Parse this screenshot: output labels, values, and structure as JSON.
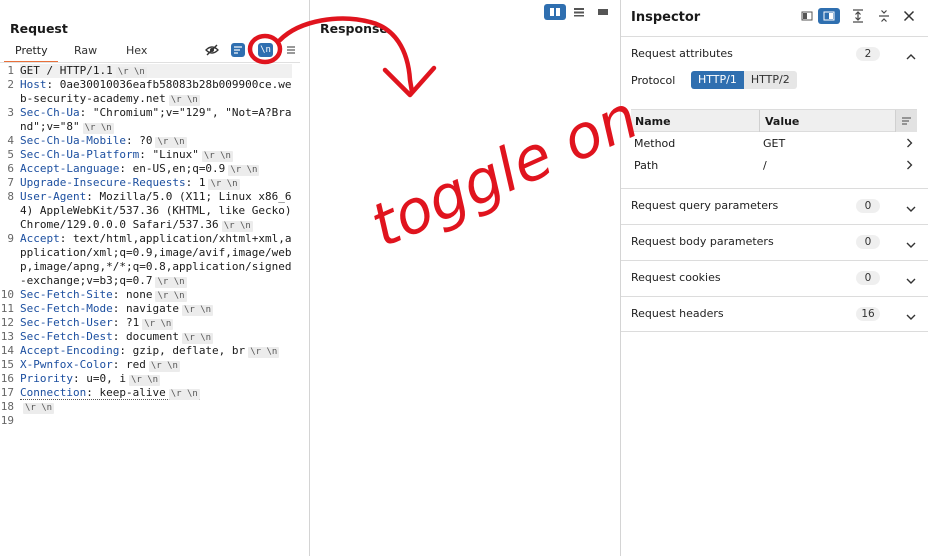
{
  "request": {
    "title": "Request",
    "tabs": [
      "Pretty",
      "Raw",
      "Hex"
    ],
    "newline_toggle": "\\n",
    "crlf": "\\r \\n",
    "lines": [
      {
        "num": "1",
        "key": "",
        "value": "GET / HTTP/1.1",
        "crlf": true
      },
      {
        "num": "2",
        "key": "Host",
        "value": "0ae30010036eafb58083b28b009900ce.web-security-academy.net",
        "crlf": true
      },
      {
        "num": "3",
        "key": "Sec-Ch-Ua",
        "value": "\"Chromium\";v=\"129\", \"Not=A?Brand\";v=\"8\"",
        "crlf": true
      },
      {
        "num": "4",
        "key": "Sec-Ch-Ua-Mobile",
        "value": "?0",
        "crlf": true
      },
      {
        "num": "5",
        "key": "Sec-Ch-Ua-Platform",
        "value": "\"Linux\"",
        "crlf": true
      },
      {
        "num": "6",
        "key": "Accept-Language",
        "value": "en-US,en;q=0.9",
        "crlf": true
      },
      {
        "num": "7",
        "key": "Upgrade-Insecure-Requests",
        "value": "1",
        "crlf": true
      },
      {
        "num": "8",
        "key": "User-Agent",
        "value": "Mozilla/5.0 (X11; Linux x86_64) AppleWebKit/537.36 (KHTML, like Gecko) Chrome/129.0.0.0 Safari/537.36",
        "crlf": true
      },
      {
        "num": "9",
        "key": "Accept",
        "value": "text/html,application/xhtml+xml,application/xml;q=0.9,image/avif,image/webp,image/apng,*/*;q=0.8,application/signed-exchange;v=b3;q=0.7",
        "crlf": true
      },
      {
        "num": "10",
        "key": "Sec-Fetch-Site",
        "value": "none",
        "crlf": true
      },
      {
        "num": "11",
        "key": "Sec-Fetch-Mode",
        "value": "navigate",
        "crlf": true
      },
      {
        "num": "12",
        "key": "Sec-Fetch-User",
        "value": "?1",
        "crlf": true
      },
      {
        "num": "13",
        "key": "Sec-Fetch-Dest",
        "value": "document",
        "crlf": true
      },
      {
        "num": "14",
        "key": "Accept-Encoding",
        "value": "gzip, deflate, br",
        "crlf": true
      },
      {
        "num": "15",
        "key": "X-Pwnfox-Color",
        "value": "red",
        "crlf": true
      },
      {
        "num": "16",
        "key": "Priority",
        "value": "u=0, i",
        "crlf": true
      },
      {
        "num": "17",
        "key": "Connection",
        "value": "keep-alive",
        "crlf": true,
        "dotted": true
      },
      {
        "num": "18",
        "key": "",
        "value": "",
        "crlf": true
      },
      {
        "num": "19",
        "key": "",
        "value": "",
        "crlf": false
      }
    ]
  },
  "response": {
    "title": "Response"
  },
  "inspector": {
    "title": "Inspector",
    "attributes": {
      "label": "Request attributes",
      "count": "2",
      "protocol_label": "Protocol",
      "protocol_options": [
        "HTTP/1",
        "HTTP/2"
      ],
      "table_headers": [
        "Name",
        "Value"
      ],
      "rows": [
        {
          "name": "Method",
          "value": "GET"
        },
        {
          "name": "Path",
          "value": "/"
        }
      ]
    },
    "sections": [
      {
        "label": "Request query parameters",
        "count": "0"
      },
      {
        "label": "Request body parameters",
        "count": "0"
      },
      {
        "label": "Request cookies",
        "count": "0"
      },
      {
        "label": "Request headers",
        "count": "16"
      }
    ]
  },
  "annotation": {
    "text": "toggle on",
    "color": "#e0141e"
  },
  "colors": {
    "accent": "#2f6fb0",
    "tab_underline": "#e8703a",
    "header_key": "#1c4fa0"
  }
}
